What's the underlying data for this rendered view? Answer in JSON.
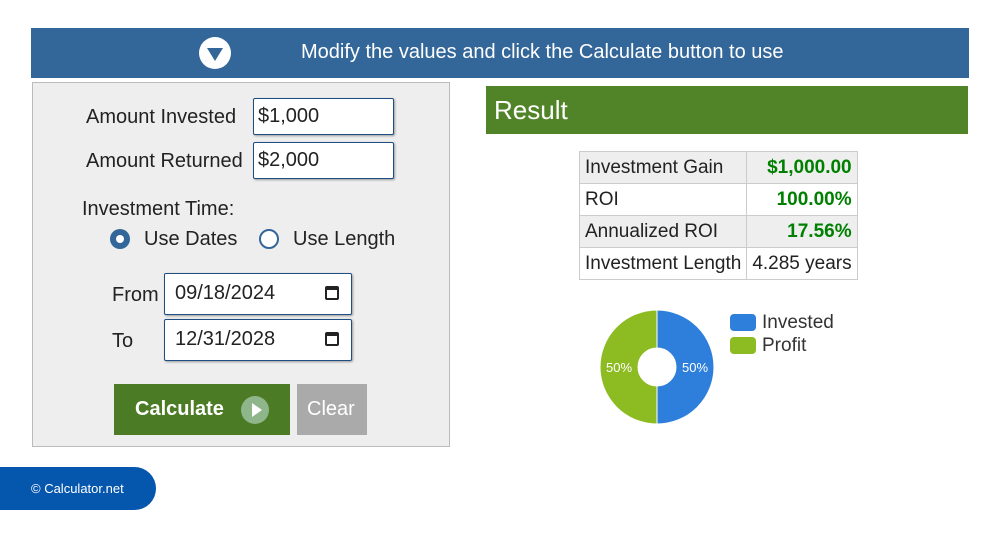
{
  "banner": {
    "icon": "chevron-down-circle-icon",
    "message": "Modify the values and click the Calculate button to use"
  },
  "form": {
    "amount_invested": {
      "label": "Amount Invested",
      "value": "$1,000"
    },
    "amount_returned": {
      "label": "Amount Returned",
      "value": "$2,000"
    },
    "investment_time_label": "Investment Time:",
    "radio_options": [
      {
        "label": "Use Dates",
        "selected": true
      },
      {
        "label": "Use Length",
        "selected": false
      }
    ],
    "from": {
      "label": "From",
      "value": "09/18/2024"
    },
    "to": {
      "label": "To",
      "value": "12/31/2028"
    },
    "calculate_label": "Calculate",
    "clear_label": "Clear"
  },
  "result": {
    "title": "Result",
    "rows": [
      {
        "label": "Investment Gain",
        "value": "$1,000.00"
      },
      {
        "label": "ROI",
        "value": "100.00%"
      },
      {
        "label": "Annualized ROI",
        "value": "17.56%"
      },
      {
        "label": "Investment Length",
        "value": "4.285 years"
      }
    ]
  },
  "chart_data": {
    "type": "pie",
    "donut": true,
    "categories": [
      "Invested",
      "Profit"
    ],
    "values": [
      50,
      50
    ],
    "labels": [
      "50%",
      "50%"
    ],
    "colors": [
      "#2e7fdc",
      "#8cbb22"
    ],
    "legend": "right"
  },
  "footer": {
    "text": "© Calculator.net"
  }
}
